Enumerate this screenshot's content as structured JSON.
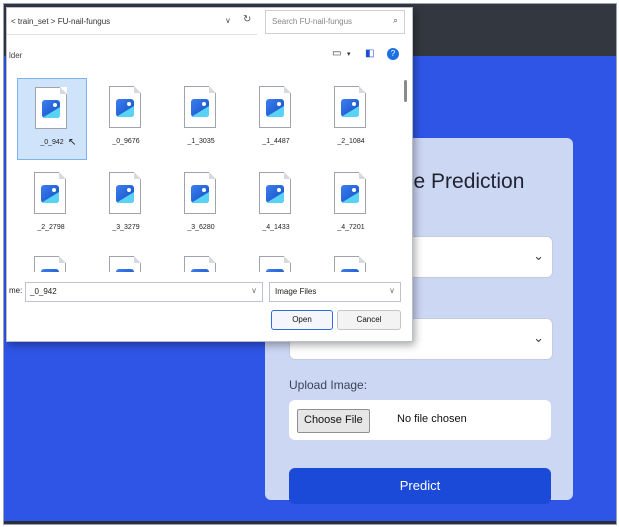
{
  "page": {
    "card_title": "se Prediction",
    "upload_label": "Upload Image:",
    "choose_file_label": "Choose File",
    "no_file_text": "No file chosen",
    "predict_label": "Predict",
    "select_chevron": "⌄"
  },
  "dialog": {
    "address_path": "< train_set > FU-nail-fungus",
    "address_dropdown": "∨",
    "refresh_icon": "↻",
    "search_placeholder": "Search FU-nail-fungus",
    "search_icon": "⌕",
    "folder_label": "lder",
    "view_icon": "▭",
    "view_dropdown": "▾",
    "pane_icon": "◧",
    "help_icon": "?",
    "files": [
      {
        "name": "_0_942",
        "selected": true
      },
      {
        "name": "_0_9676"
      },
      {
        "name": "_1_3035"
      },
      {
        "name": "_1_4487"
      },
      {
        "name": "_2_1084"
      },
      {
        "name": "_2_2798"
      },
      {
        "name": "_3_3279"
      },
      {
        "name": "_3_6280"
      },
      {
        "name": "_4_1433"
      },
      {
        "name": "_4_7201"
      },
      {
        "name": ""
      },
      {
        "name": ""
      },
      {
        "name": ""
      },
      {
        "name": ""
      },
      {
        "name": ""
      }
    ],
    "filename_label": "me:",
    "filename_value": "_0_942",
    "filename_dropdown": "∨",
    "filetype_value": "Image Files",
    "filetype_dropdown": "∨",
    "open_label": "Open",
    "cancel_label": "Cancel"
  },
  "colors": {
    "page_background": "#2e55e6",
    "card_background": "#ccd7f4",
    "predict_button": "#1b49d8",
    "topbar": "#33373f"
  }
}
